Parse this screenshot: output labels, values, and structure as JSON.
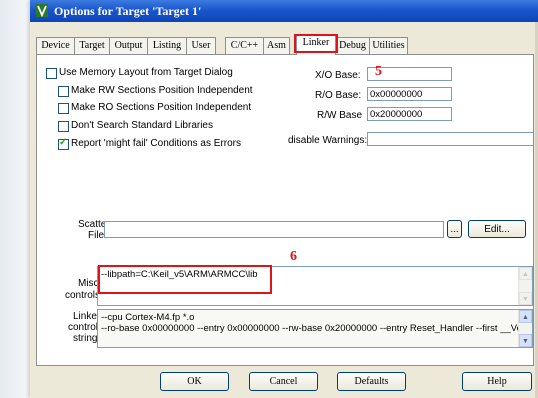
{
  "window": {
    "title": "Options for Target 'Target 1'"
  },
  "tabs": [
    {
      "label": "Device"
    },
    {
      "label": "Target"
    },
    {
      "label": "Output"
    },
    {
      "label": "Listing"
    },
    {
      "label": "User"
    },
    {
      "label": "C/C++"
    },
    {
      "label": "Asm"
    },
    {
      "label": "Linker"
    },
    {
      "label": "Debug"
    },
    {
      "label": "Utilities"
    }
  ],
  "linker": {
    "use_memory_layout": {
      "label": "Use Memory Layout from Target Dialog",
      "checked": false
    },
    "make_rw": {
      "label": "Make RW Sections Position Independent",
      "checked": false
    },
    "make_ro": {
      "label": "Make RO Sections Position Independent",
      "checked": false
    },
    "dont_search": {
      "label": "Don't Search Standard Libraries",
      "checked": false
    },
    "report_might_fail": {
      "label": "Report 'might fail' Conditions as Errors",
      "checked": true
    },
    "xo_base": {
      "label": "X/O Base:",
      "value": ""
    },
    "r0_base": {
      "label": "R/O Base:",
      "value": "0x00000000"
    },
    "rw_base": {
      "label": "R/W Base",
      "value": "0x20000000"
    },
    "disable_warnings": {
      "label": "disable Warnings:",
      "value": ""
    },
    "scatter_file": {
      "label_line1": "Scatter",
      "label_line2": "File",
      "value": "",
      "browse_label": "...",
      "edit_label": "Edit..."
    },
    "misc_controls": {
      "label_line1": "Misc",
      "label_line2": "controls",
      "value": "--libpath=C:\\Keil_v5\\ARM\\ARMCC\\lib"
    },
    "linker_control": {
      "label_line1": "Linker",
      "label_line2": "control",
      "label_line3": "string",
      "line1": "--cpu Cortex-M4.fp *.o",
      "line2": "--ro-base 0x00000000 --entry 0x00000000 --rw-base 0x20000000 --entry Reset_Handler --first __Vecto"
    }
  },
  "annotations": {
    "five": "5",
    "six": "6",
    "color": "#e0131b"
  },
  "buttons": {
    "ok": "OK",
    "cancel": "Cancel",
    "defaults": "Defaults",
    "help": "Help"
  },
  "scroll_icons": {
    "up": "scroll-up-icon",
    "down": "scroll-down-icon"
  },
  "colors": {
    "titlebar": "#1a56cc",
    "dialog_bg": "#ece9d8",
    "check_mark": "#21a121"
  }
}
